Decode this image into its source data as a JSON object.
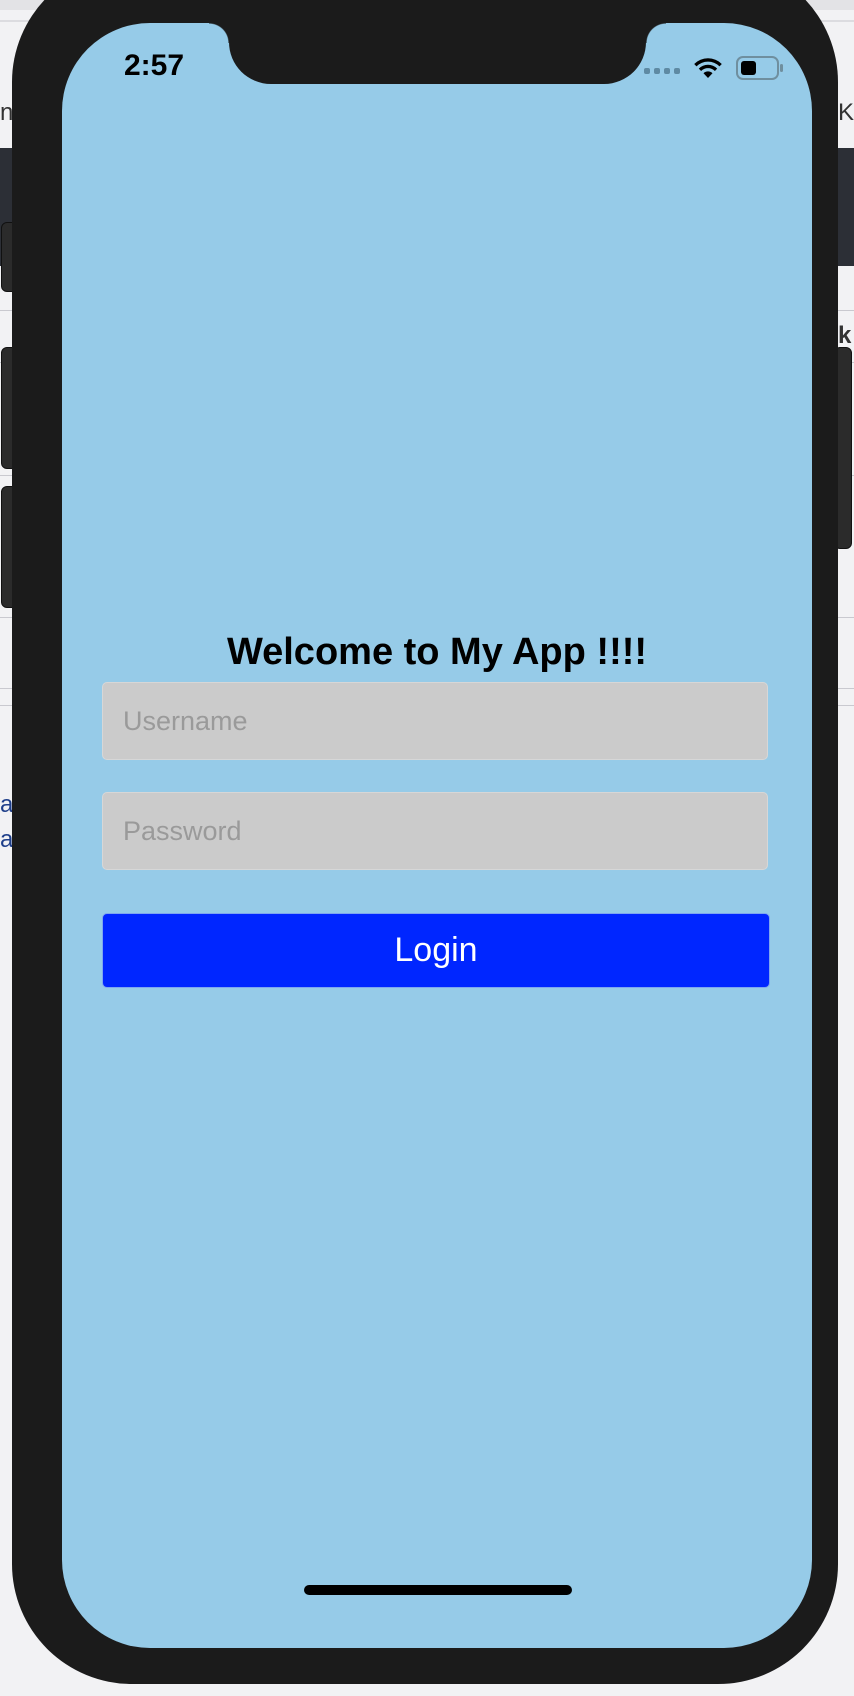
{
  "status_bar": {
    "time": "2:57",
    "icons": [
      "cellular-signal-icon",
      "wifi-icon",
      "battery-icon"
    ]
  },
  "background_page": {
    "edge_texts": [
      "n",
      "K",
      "k",
      "a",
      "a"
    ]
  },
  "login": {
    "welcome_title": "Welcome to My App !!!!",
    "username_placeholder": "Username",
    "password_placeholder": "Password",
    "login_label": "Login"
  },
  "colors": {
    "screen_background": "#96cbe8",
    "input_background": "#cbcbcb",
    "login_button": "#0026ff",
    "device_frame": "#1b1b1b"
  }
}
